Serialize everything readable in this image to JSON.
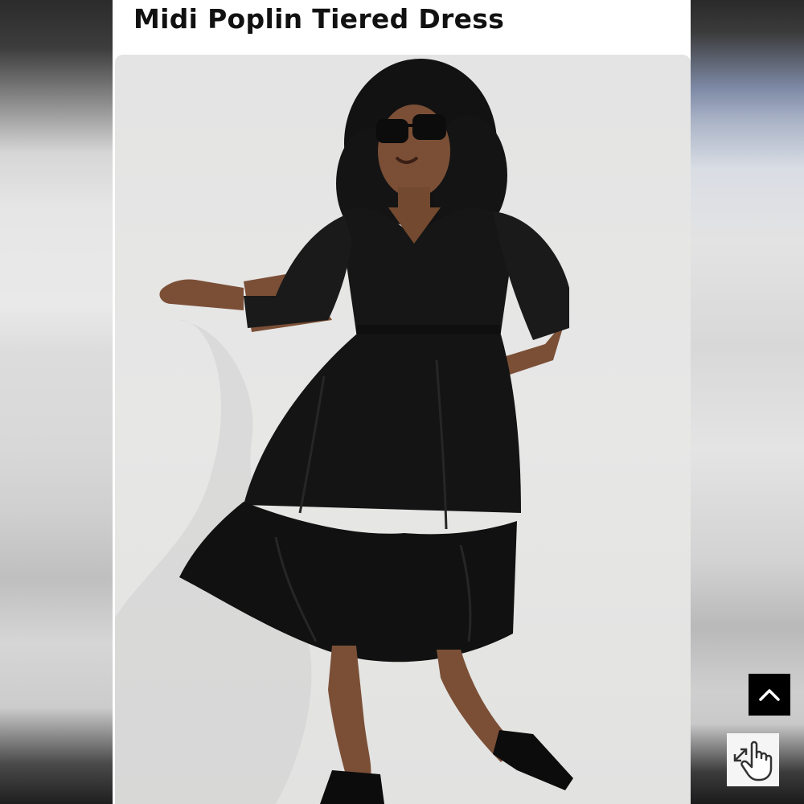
{
  "product": {
    "title": "Midi Poplin Tiered Dress"
  },
  "icons": {
    "scroll_top": "chevron-up-icon",
    "zoom": "hand-pointer-expand-icon"
  },
  "colors": {
    "title_text": "#111111",
    "scroll_button_bg": "#000000",
    "dress": "#141414"
  }
}
